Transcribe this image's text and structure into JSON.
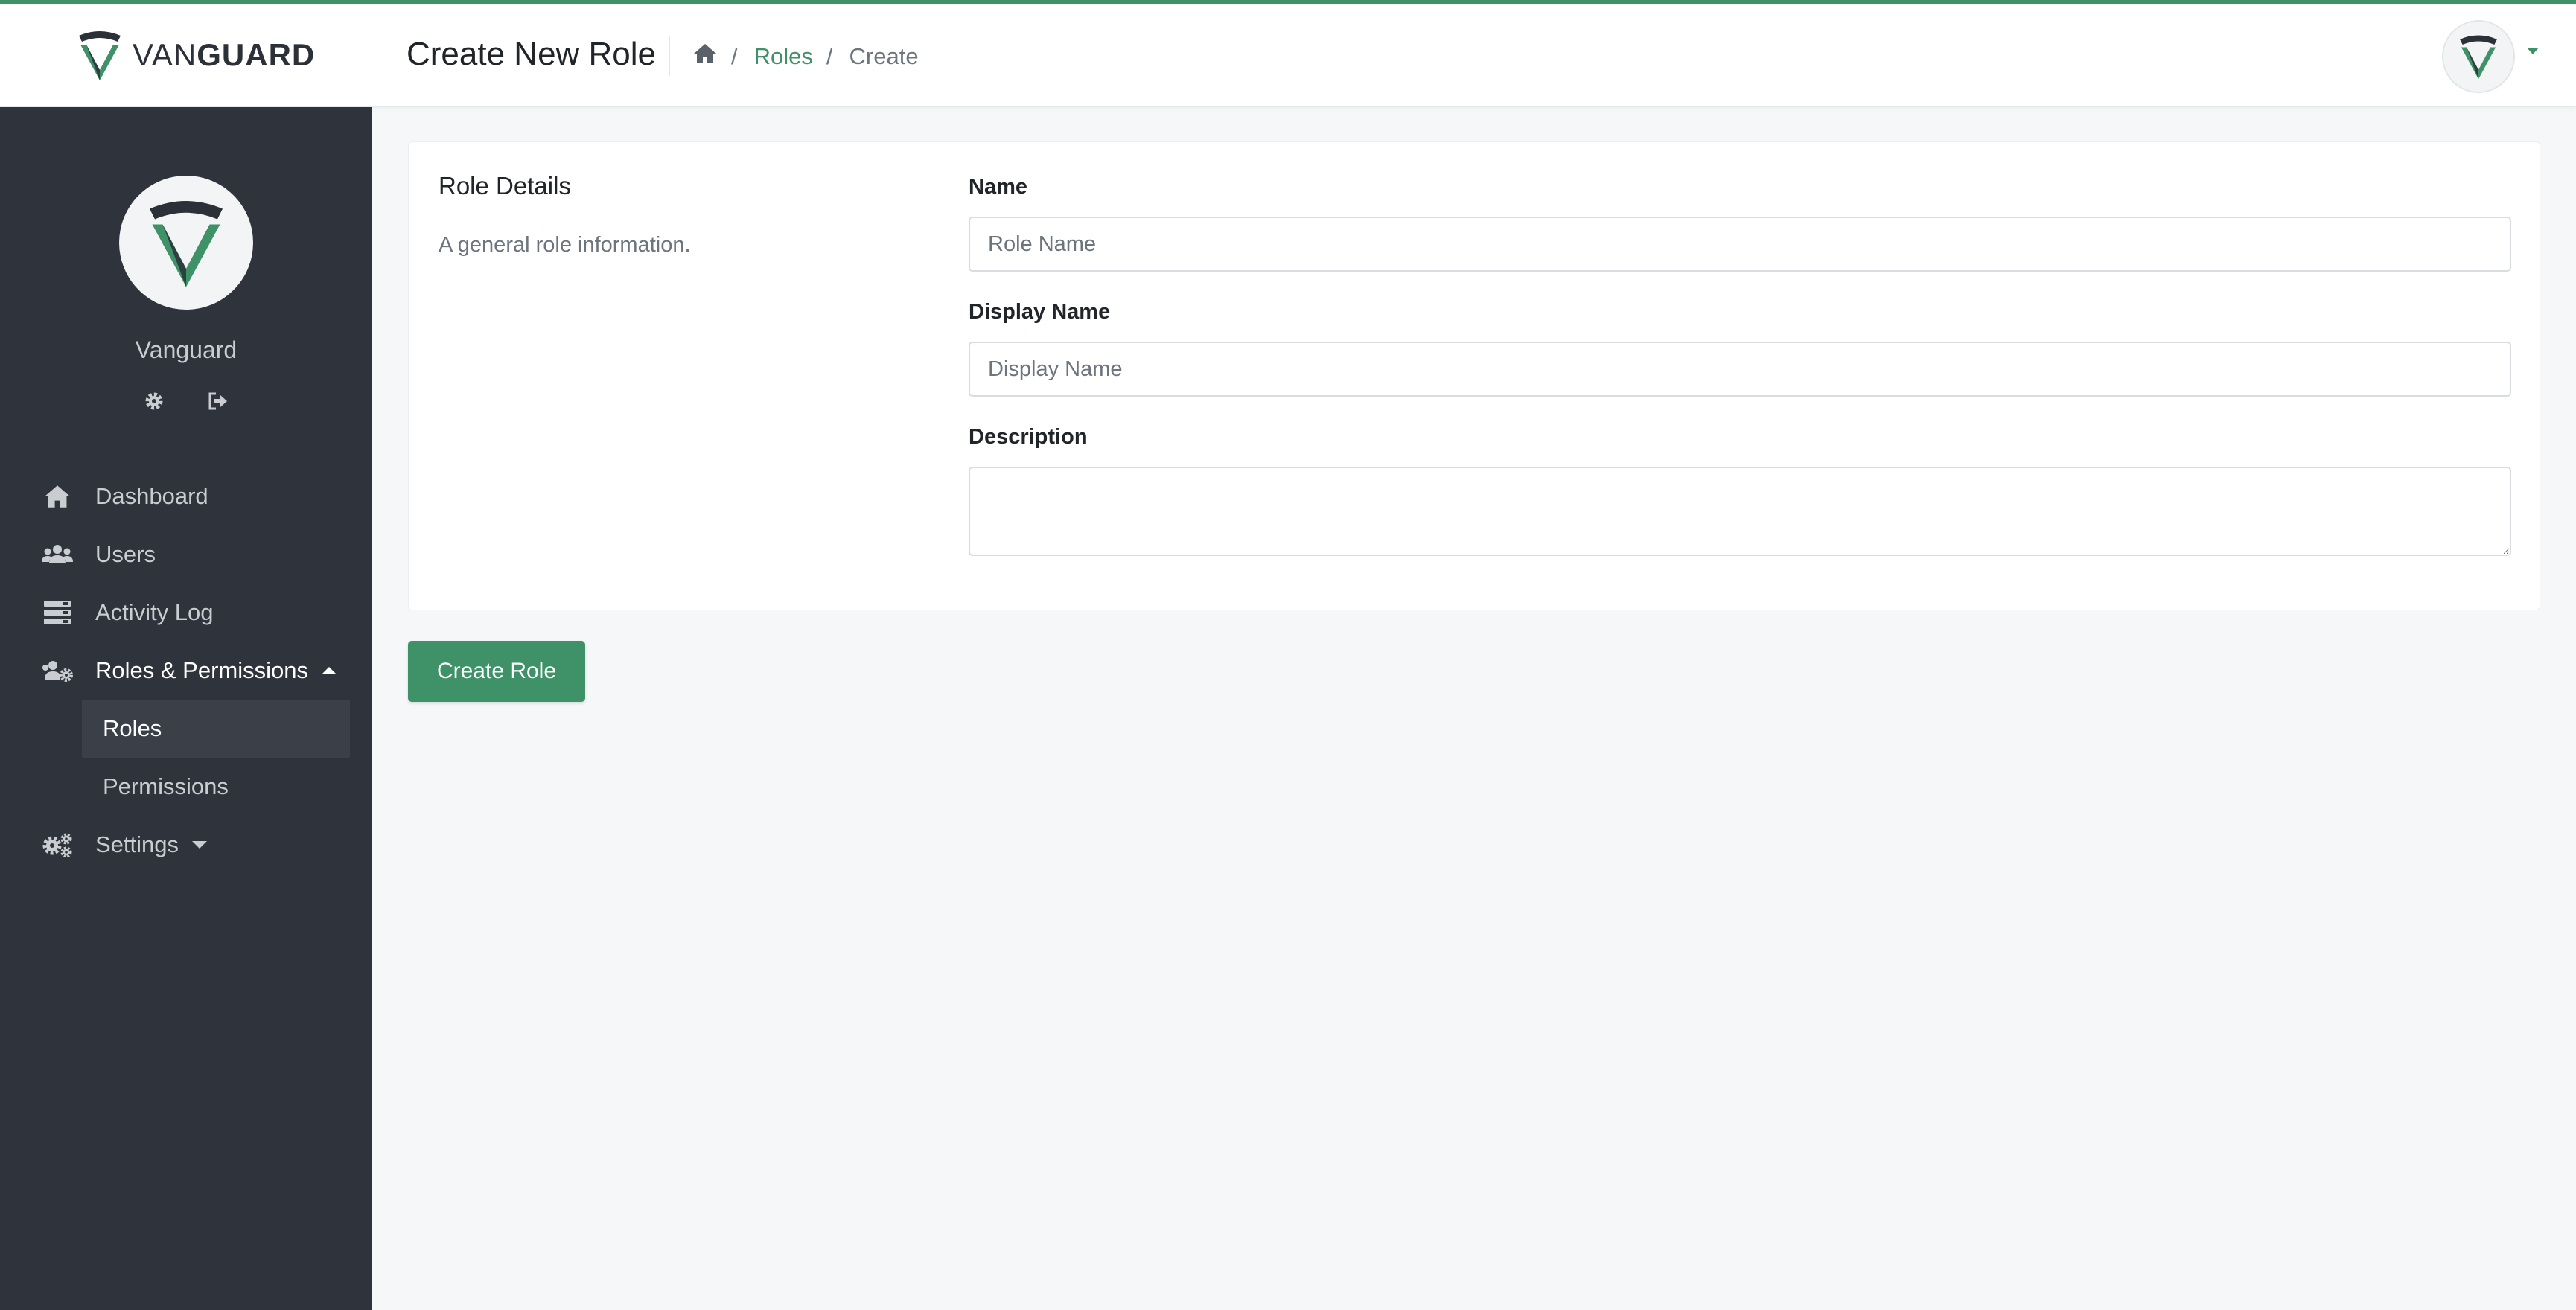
{
  "app": {
    "brand_light": "VAN",
    "brand_bold": "GUARD",
    "logo_icon": "vanguard-shield-logo"
  },
  "header": {
    "page_title": "Create New Role",
    "breadcrumb": {
      "home_icon": "home-icon",
      "sep1": "/",
      "link": "Roles",
      "sep2": "/",
      "current": "Create"
    },
    "avatar_menu_icon": "caret-down-icon"
  },
  "sidebar": {
    "username": "Vanguard",
    "icons": [
      "gear-icon",
      "sign-out-icon"
    ],
    "items": [
      {
        "label": "Dashboard",
        "icon": "home-icon"
      },
      {
        "label": "Users",
        "icon": "users-icon"
      },
      {
        "label": "Activity Log",
        "icon": "server-icon"
      },
      {
        "label": "Roles & Permissions",
        "icon": "user-cog-icon",
        "expanded": true
      },
      {
        "label": "Settings",
        "icon": "cogs-icon",
        "expanded": false
      }
    ],
    "subitems": [
      {
        "label": "Roles",
        "active": true
      },
      {
        "label": "Permissions",
        "active": false
      }
    ]
  },
  "form": {
    "section_title": "Role Details",
    "section_description": "A general role information.",
    "name_label": "Name",
    "name_placeholder": "Role Name",
    "display_name_label": "Display Name",
    "display_name_placeholder": "Display Name",
    "description_label": "Description",
    "description_value": ""
  },
  "actions": {
    "submit_label": "Create Role"
  },
  "colors": {
    "accent": "#3f9168",
    "sidebar_bg": "#2f333b",
    "page_bg": "#f5f7f9"
  }
}
